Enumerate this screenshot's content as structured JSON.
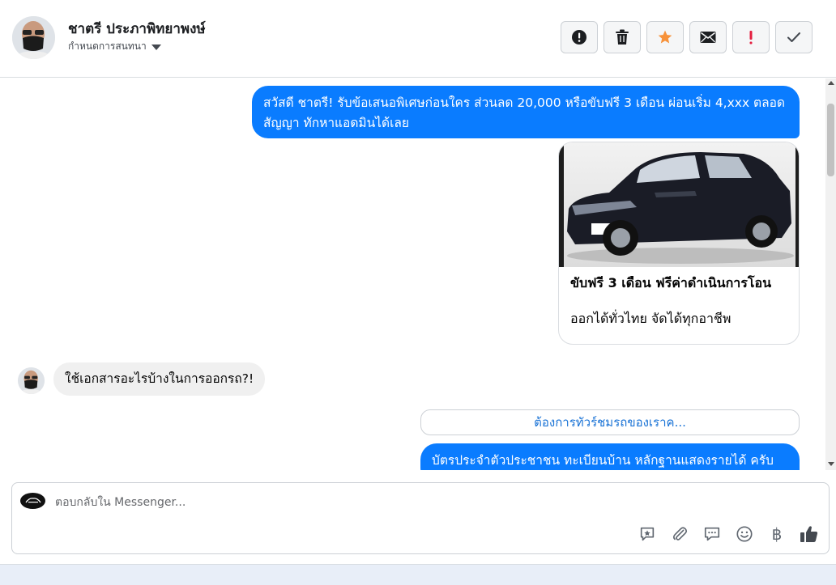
{
  "header": {
    "contact_name": "ชาตรี ประภาพิทยาพงษ์",
    "assign_label": "กำหนดการสนทนา",
    "actions": [
      {
        "icon": "alert-circle-icon"
      },
      {
        "icon": "trash-icon"
      },
      {
        "icon": "star-icon",
        "color": "#f7923a"
      },
      {
        "icon": "envelope-icon"
      },
      {
        "icon": "exclamation-icon",
        "color": "#e41e3f"
      },
      {
        "icon": "check-icon"
      }
    ]
  },
  "thread": {
    "outgoing_message": "สวัสดี ชาตรี! รับข้อเสนอพิเศษก่อนใคร ส่วนลด 20,000 หรือขับฟรี 3 เดือน ผ่อนเริ่ม 4,xxx ตลอดสัญญา ทักหาแอดมินได้เลย",
    "card": {
      "title": "ขับฟรี 3 เดือน ฟรีค่าดำเนินการโอน",
      "subtitle": "ออกได้ทั่วไทย จัดได้ทุกอาชีพ"
    },
    "incoming_message": "ใช้เอกสารอะไรบ้างในการออกรถ?!",
    "quick_reply": "ต้องการทัวร์ชมรถของเราค...",
    "outgoing_message_2": "บัตรประจำตัวประชาชน ทะเบียนบ้าน หลักฐานแสดงรายได้ ครับ"
  },
  "composer": {
    "placeholder": "ตอบกลับใน Messenger...",
    "tools": [
      "saved-reply-icon",
      "attachment-icon",
      "chat-bubble-icon",
      "emoji-icon",
      "baht-icon",
      "like-icon"
    ],
    "baht_symbol": "฿"
  },
  "colors": {
    "accent": "#0a7cff",
    "link": "#1a73d6",
    "star": "#f7923a",
    "danger": "#e41e3f"
  }
}
